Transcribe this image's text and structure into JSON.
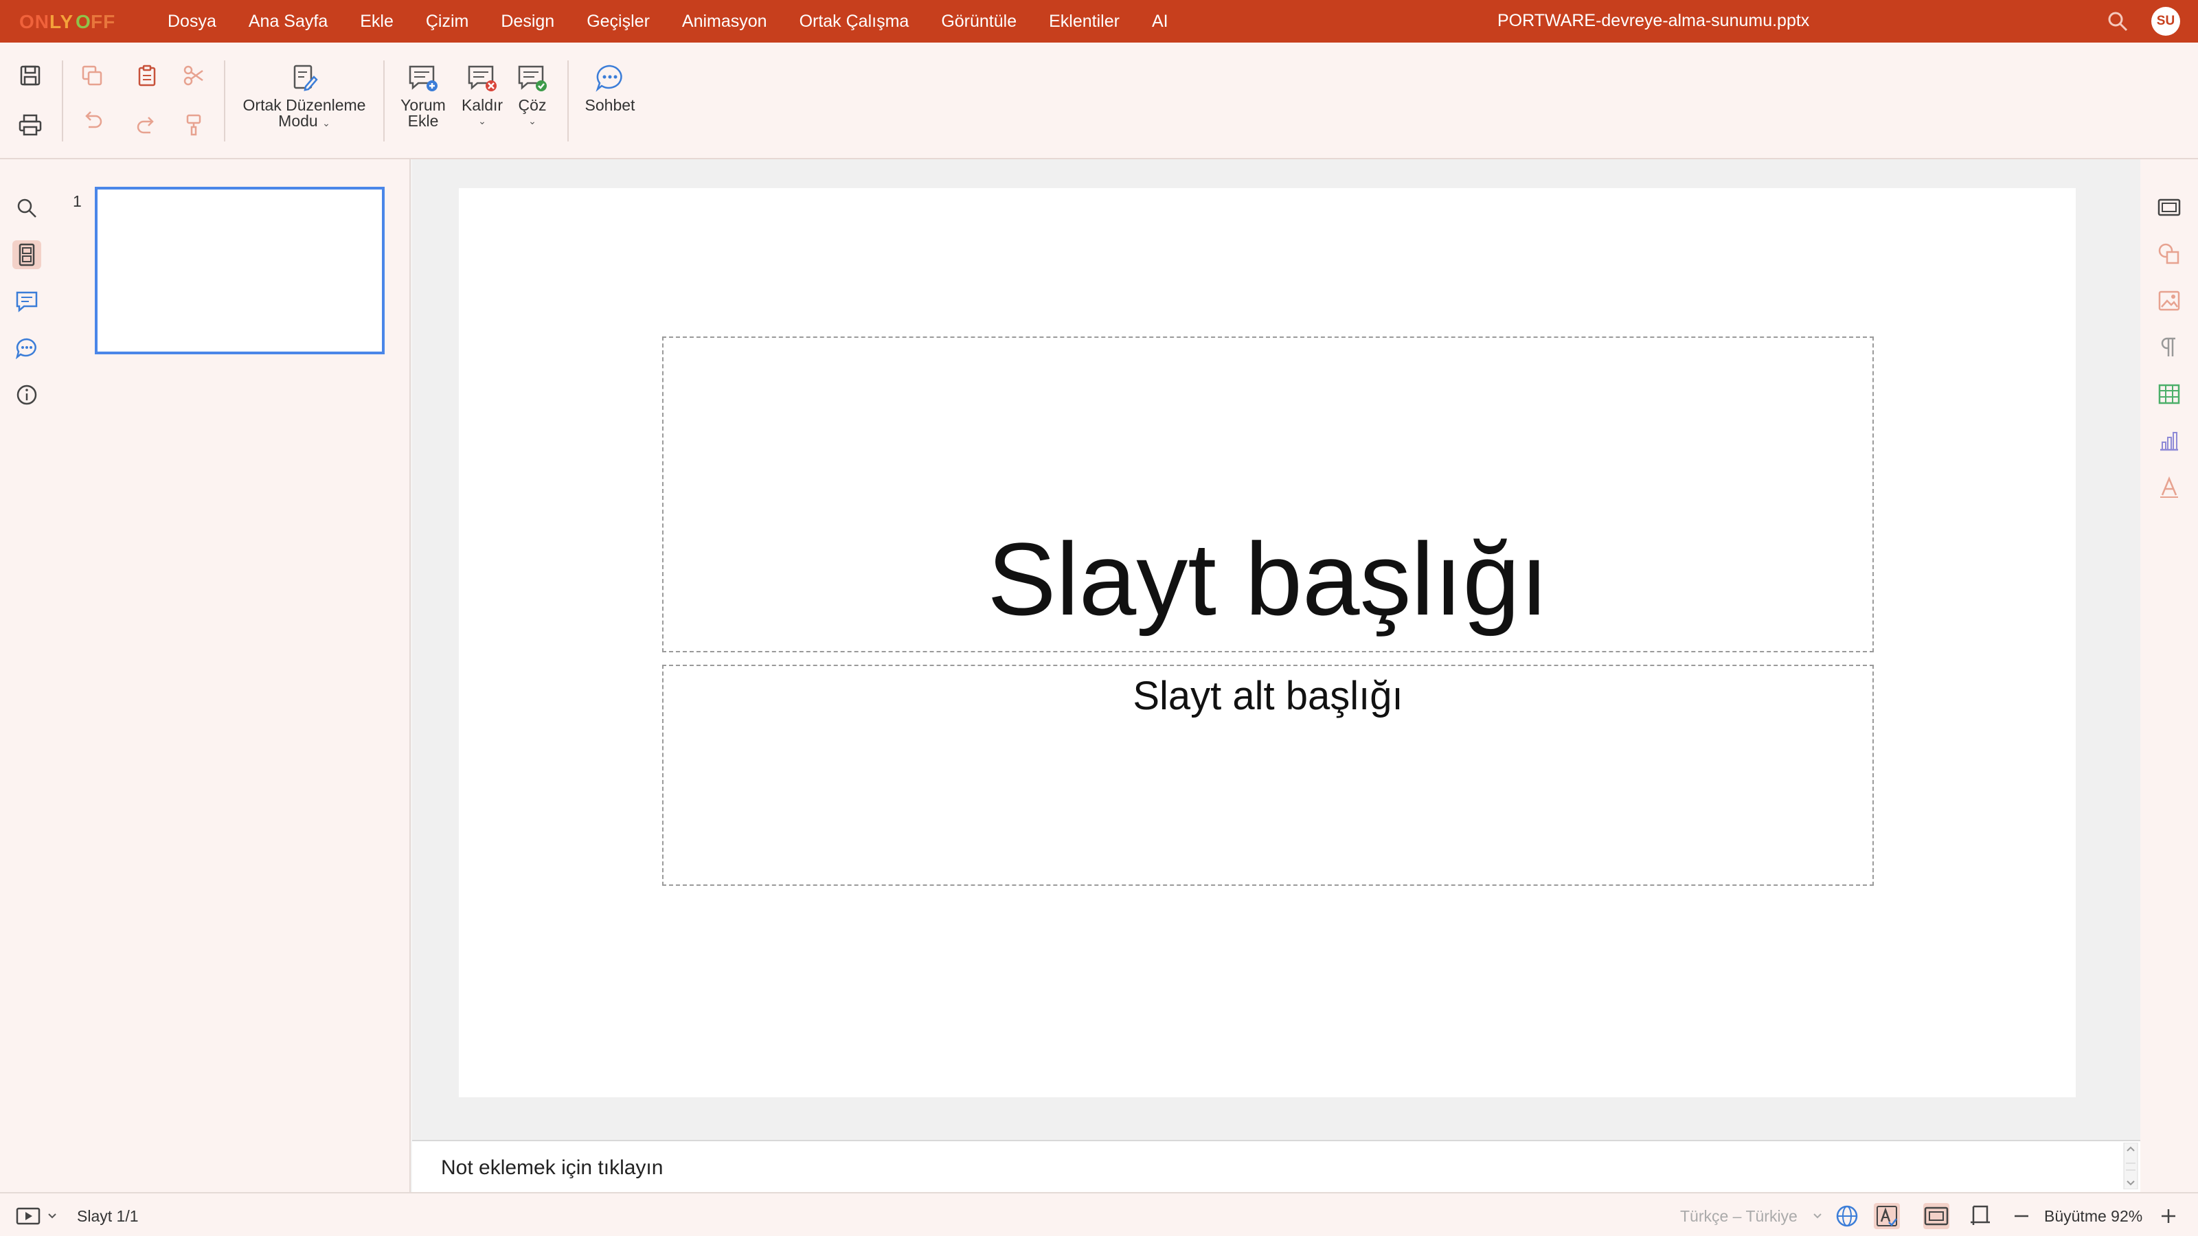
{
  "app": {
    "logo_text": "ONLYOFFICE",
    "document_title": "PORTWARE-devreye-alma-sunumu.pptx",
    "user_initials": "SU"
  },
  "menu": {
    "items": [
      "Dosya",
      "Ana Sayfa",
      "Ekle",
      "Çizim",
      "Design",
      "Geçişler",
      "Animasyon",
      "Ortak Çalışma",
      "Görüntüle",
      "Eklentiler",
      "AI"
    ]
  },
  "toolbar": {
    "co_editing_line1": "Ortak Düzenleme",
    "co_editing_line2": "Modu",
    "add_comment_line1": "Yorum",
    "add_comment_line2": "Ekle",
    "remove": "Kaldır",
    "resolve": "Çöz",
    "chat": "Sohbet"
  },
  "slides_panel": {
    "slide_number": "1"
  },
  "slide": {
    "title": "Slayt başlığı",
    "subtitle": "Slayt alt başlığı"
  },
  "notes": {
    "placeholder": "Not eklemek için tıklayın"
  },
  "statusbar": {
    "slide_counter": "Slayt 1/1",
    "language": "Türkçe – Türkiye",
    "zoom_label": "Büyütme 92%"
  },
  "colors": {
    "accent": "#c73f1d",
    "panel": "#fcf3f1",
    "selection": "#4a86e8"
  }
}
